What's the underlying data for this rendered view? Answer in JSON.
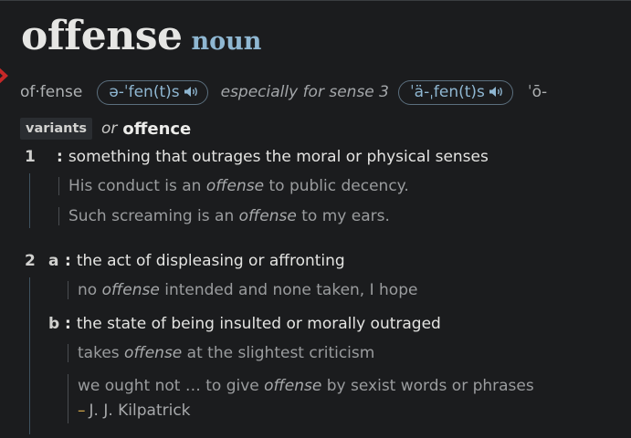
{
  "entry": {
    "headword": "offense",
    "part_of_speech": "noun",
    "syllabification": "of·fense",
    "pronunciation_1": "ə-ˈfen(t)s",
    "sense_note": "especially for sense 3",
    "pronunciation_2": "ˈä-ˌfen(t)s",
    "pronunciation_3_partial": "ˈō-",
    "variants_label": "variants",
    "variants_or": "or",
    "variant_word": "offence"
  },
  "senses": [
    {
      "number": "1",
      "definitions": [
        {
          "letter": "",
          "text": "something that outrages the moral or physical senses",
          "examples": [
            {
              "before": "His conduct is an ",
              "em": "offense",
              "after": " to public decency."
            },
            {
              "before": "Such screaming is an ",
              "em": "offense",
              "after": " to my ears."
            }
          ]
        }
      ]
    },
    {
      "number": "2",
      "definitions": [
        {
          "letter": "a",
          "text": "the act of displeasing or affronting",
          "examples": [
            {
              "before": "no ",
              "em": "offense",
              "after": " intended and none taken, I hope"
            }
          ]
        },
        {
          "letter": "b",
          "text": "the state of being insulted or morally outraged",
          "examples": [
            {
              "before": "takes ",
              "em": "offense",
              "after": " at the slightest criticism"
            },
            {
              "before": "we ought not … to give ",
              "em": "offense",
              "after": " by sexist words or phrases",
              "attribution": "J. J. Kilpatrick"
            }
          ]
        }
      ]
    }
  ],
  "symbols": {
    "colon": ":",
    "dash": "–"
  },
  "colors": {
    "background": "#1b1c1e",
    "accent": "#8fb7d2",
    "mark": "#c62828",
    "attribution_dash": "#d2a64a"
  },
  "icons": {
    "audio": "speaker-icon",
    "mark": "close-icon"
  }
}
